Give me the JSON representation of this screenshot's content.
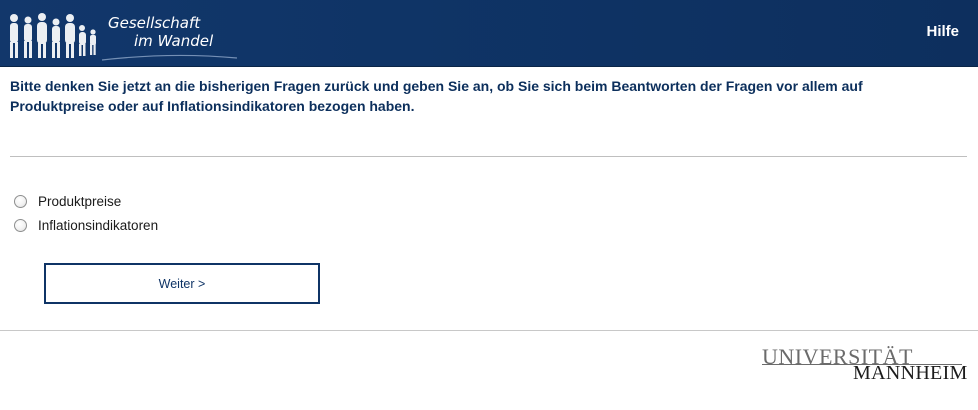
{
  "header": {
    "logo_line1": "Gesellschaft",
    "logo_line2": "im Wandel",
    "help_label": "Hilfe",
    "background_color": "#0f3466"
  },
  "question": {
    "text": "Bitte denken Sie jetzt an die bisherigen Fragen zurück und geben Sie an, ob Sie sich beim Beantworten der Fragen vor allem auf Produktpreise oder auf Inflationsindikatoren bezogen haben."
  },
  "options": [
    {
      "label": "Produktpreise",
      "selected": false
    },
    {
      "label": "Inflationsindikatoren",
      "selected": false
    }
  ],
  "next_button": {
    "label": "Weiter >"
  },
  "footer": {
    "logo_line1": "UNIVERSITÄT",
    "logo_line2": "MANNHEIM"
  }
}
